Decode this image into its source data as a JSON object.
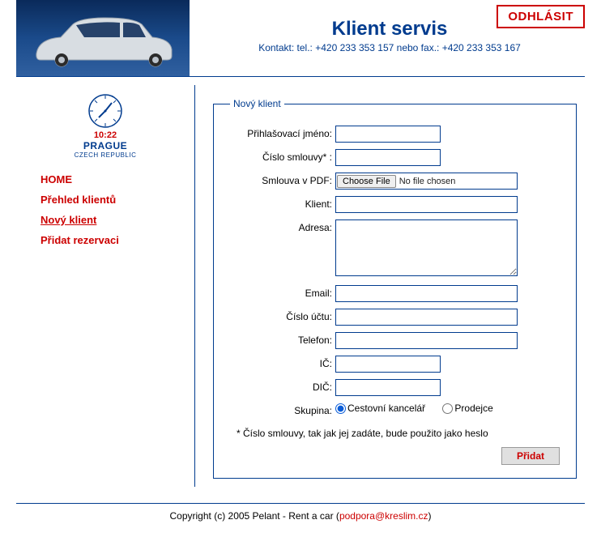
{
  "header": {
    "title": "Klient servis",
    "contact": "Kontakt: tel.: +420 233 353 157 nebo fax.: +420 233 353 167",
    "logout": "ODHLÁSIT"
  },
  "clock": {
    "time": "10:22",
    "city": "PRAGUE",
    "country": "CZECH REPUBLIC"
  },
  "nav": {
    "home": "HOME",
    "overview": "Přehled klientů",
    "new_client": "Nový klient",
    "add_reservation": "Přidat rezervaci"
  },
  "form": {
    "legend": "Nový klient",
    "labels": {
      "login": "Přihlašovací jméno:",
      "contract_no": "Číslo smlouvy* :",
      "contract_pdf": "Smlouva v PDF:",
      "client": "Klient:",
      "address": "Adresa:",
      "email": "Email:",
      "account_no": "Číslo účtu:",
      "phone": "Telefon:",
      "ico": "IČ:",
      "dic": "DIČ:",
      "group": "Skupina:"
    },
    "file": {
      "choose": "Choose File",
      "none": "No file chosen"
    },
    "radios": {
      "travel_agency": "Cestovní kancelář",
      "seller": "Prodejce"
    },
    "note": "* Číslo smlouvy, tak jak jej zadáte, bude použito jako heslo",
    "submit": "Přidat",
    "values": {
      "login": "",
      "contract_no": "",
      "client": "",
      "address": "",
      "email": "",
      "account_no": "",
      "phone": "",
      "ico": "",
      "dic": ""
    }
  },
  "footer": {
    "prefix": "Copyright (c) 2005 Pelant - Rent a car (",
    "email": "podpora@kreslim.cz",
    "suffix": ")"
  }
}
